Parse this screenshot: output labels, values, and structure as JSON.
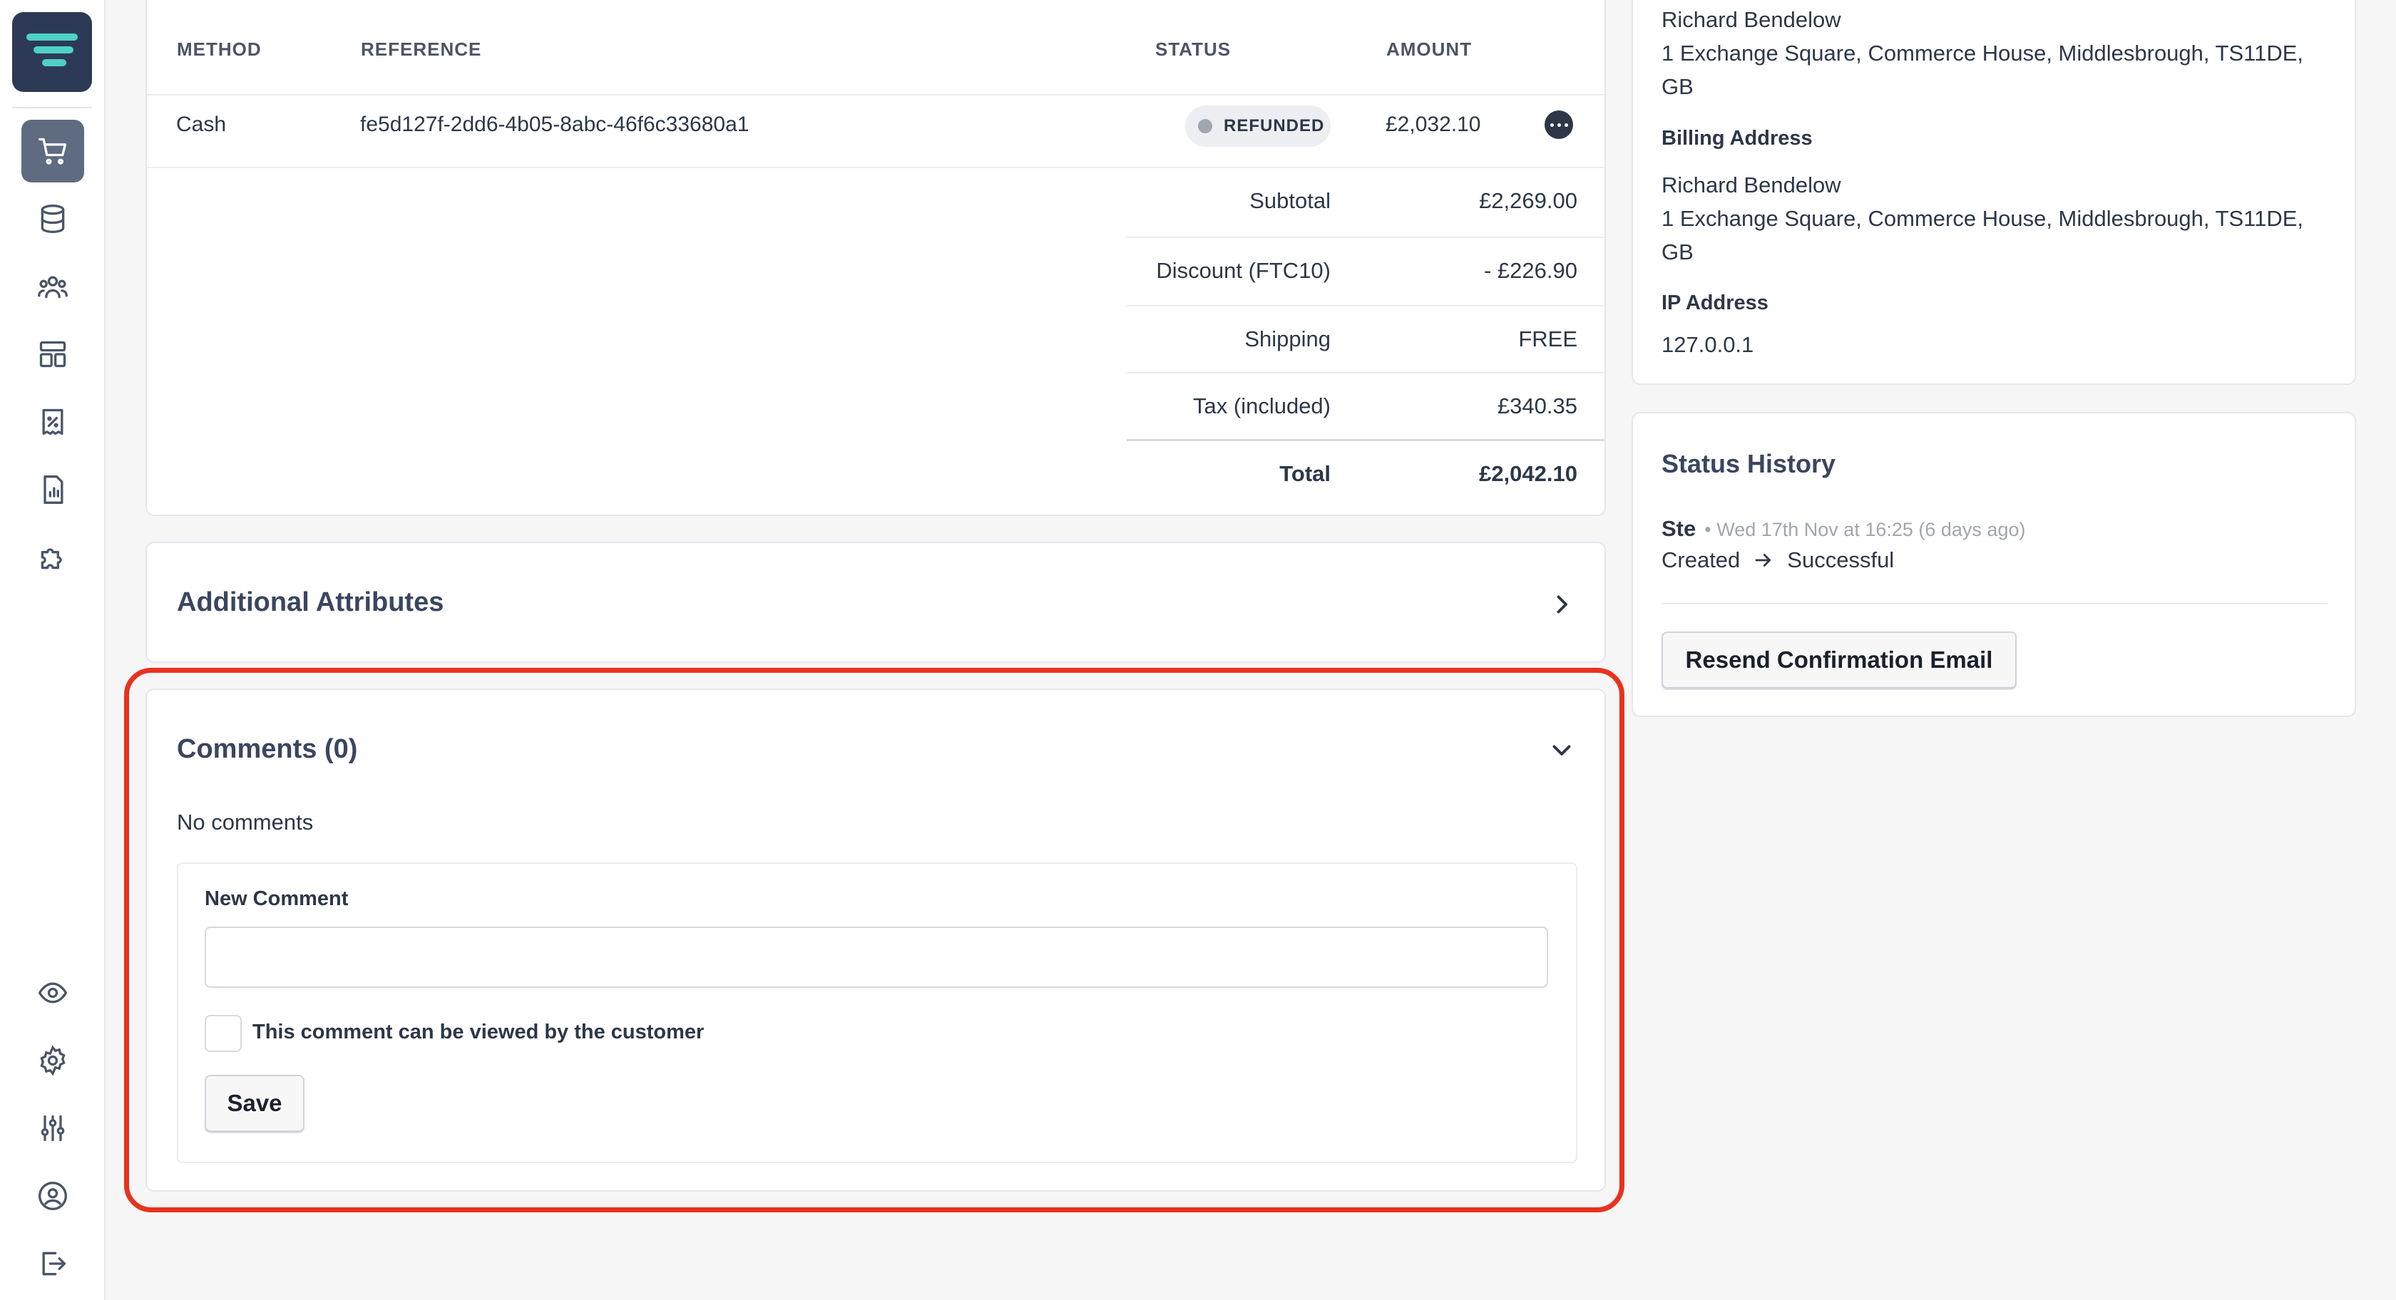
{
  "sidebar": {
    "logo": "logo-icon",
    "top_icons": [
      "cart-icon",
      "database-icon",
      "users-icon",
      "layout-icon",
      "receipt-discount-icon",
      "report-icon",
      "puzzle-icon"
    ],
    "bottom_icons": [
      "eye-icon",
      "gear-icon",
      "sliders-icon",
      "user-circle-icon",
      "logout-icon"
    ]
  },
  "payments": {
    "headers": {
      "method": "Method",
      "reference": "Reference",
      "status": "Status",
      "amount": "Amount"
    },
    "row": {
      "method": "Cash",
      "reference": "fe5d127f-2dd6-4b05-8abc-46f6c33680a1",
      "status": "Refunded",
      "amount": "£2,032.10"
    },
    "summary": [
      {
        "label": "Subtotal",
        "value": "£2,269.00"
      },
      {
        "label": "Discount (FTC10)",
        "value": "- £226.90"
      },
      {
        "label": "Shipping",
        "value": "FREE"
      },
      {
        "label": "Tax (included)",
        "value": "£340.35"
      },
      {
        "label": "Total",
        "value": "£2,042.10"
      }
    ]
  },
  "additional_attributes": {
    "title": "Additional Attributes"
  },
  "comments": {
    "title": "Comments (0)",
    "empty_text": "No comments",
    "new_comment_label": "New Comment",
    "input_value": "",
    "checkbox_label": "This comment can be viewed by the customer",
    "save_label": "Save"
  },
  "address_card": {
    "shipping_name": "Richard Bendelow",
    "shipping_line1": "1 Exchange Square, Commerce House, Middlesbrough, TS11DE,",
    "shipping_line2": "GB",
    "billing_title": "Billing Address",
    "billing_name": "Richard Bendelow",
    "billing_line1": "1 Exchange Square, Commerce House, Middlesbrough, TS11DE,",
    "billing_line2": "GB",
    "ip_title": "IP Address",
    "ip_value": "127.0.0.1"
  },
  "status_history": {
    "title": "Status History",
    "entry": {
      "user": "Ste",
      "meta": "• Wed 17th Nov at 16:25 (6 days ago)",
      "from": "Created",
      "to": "Successful"
    },
    "resend_label": "Resend Confirmation Email"
  },
  "colors": {
    "highlight": "#e8321e",
    "sidebar_active": "#5f6b80",
    "logo_bg": "#2d3a55",
    "logo_accent": "#4fd1c5"
  }
}
